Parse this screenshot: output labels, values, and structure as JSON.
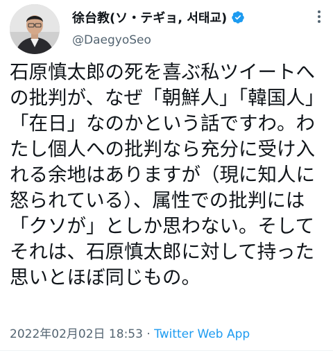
{
  "tweet": {
    "author": {
      "display_name": "徐台教(ソ・テギョ, 서태교)",
      "handle": "@DaegyoSeo",
      "verified": true
    },
    "body": "石原慎太郎の死を喜ぶ私ツイートへの批判が、なぜ「朝鮮人」「韓国人」「在日」なのかという話ですわ。わたし個人への批判なら充分に受け入れる余地はありますが（現に知人に怒られている）、属性での批判には「クソが」としか思わない。そしてそれは、石原慎太郎に対して持った思いとほぼ同じもの。",
    "timestamp": "2022年02月02日 18:53",
    "separator": " · ",
    "source": "Twitter Web App"
  },
  "colors": {
    "text": "#0f1419",
    "secondary": "#536471",
    "accent": "#1d9bf0"
  },
  "icons": {
    "verified": "verified-badge-icon",
    "more": "more-options-icon"
  }
}
